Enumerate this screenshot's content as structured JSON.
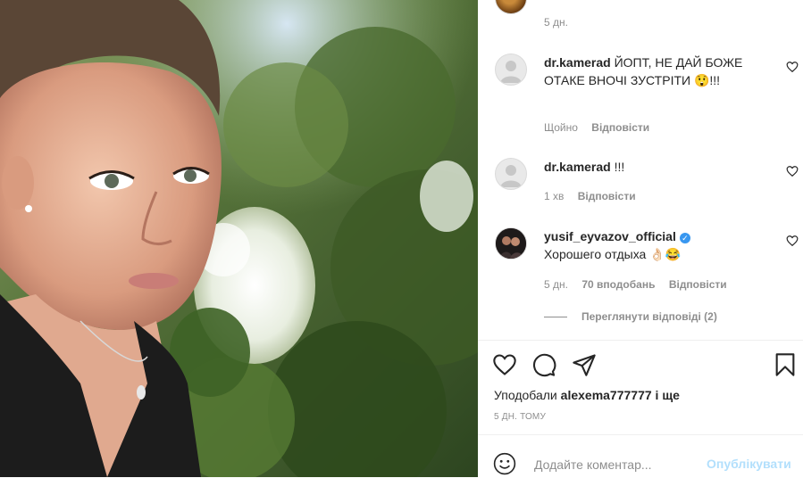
{
  "post": {
    "photo_description": "selfie-photo"
  },
  "comments": {
    "top_partial_time": "5 дн.",
    "items": [
      {
        "username": "dr.kamerad",
        "text": "ЙОПТ, НЕ ДАЙ БОЖЕ ОТАКЕ ВНОЧІ ЗУСТРІТИ 😲!!!",
        "time": "Щойно",
        "reply": "Відповісти"
      },
      {
        "username": "dr.kamerad",
        "text": "!!!",
        "time": "1 хв",
        "reply": "Відповісти"
      },
      {
        "username": "yusif_eyvazov_official",
        "verified": true,
        "text": "Хорошего отдыха 👌🏻😂",
        "time": "5 дн.",
        "likes": "70 вподобань",
        "reply": "Відповісти"
      }
    ],
    "view_replies": "Переглянути відповіді (2)"
  },
  "liked_by": {
    "prefix": "Уподобали",
    "user": "alexema777777",
    "suffix": "і ще"
  },
  "date_label": "5 ДН. ТОМУ",
  "add_comment": {
    "placeholder": "Додайте коментар...",
    "publish": "Опублікувати"
  },
  "colors": {
    "link_disabled": "#b2dffc",
    "secondary_text": "#8e8e8e",
    "verified": "#3897f0"
  }
}
